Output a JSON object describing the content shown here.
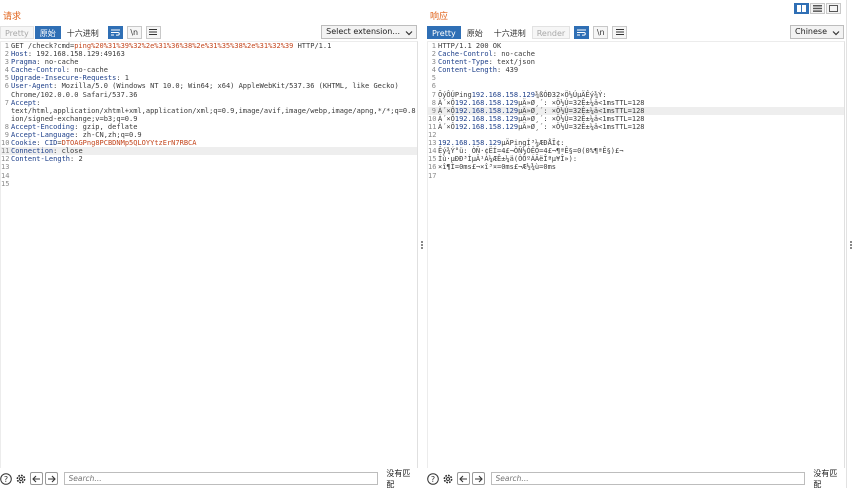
{
  "request": {
    "title": "请求",
    "tabs": [
      {
        "label": "Pretty",
        "state": "disabled"
      },
      {
        "label": "原始",
        "state": "active"
      },
      {
        "label": "十六进制",
        "state": "normal"
      }
    ],
    "icon_newline": "\\n",
    "select_label": "Select extension...",
    "lines": [
      {
        "n": "1",
        "parts": [
          {
            "t": "GET /check?cmd=",
            "c": "v"
          },
          {
            "t": "ping%20%31%39%32%2e%31%36%38%2e%31%35%38%2e%31%32%39",
            "c": "u"
          },
          {
            "t": " HTTP/1.1",
            "c": "v"
          }
        ]
      },
      {
        "n": "2",
        "parts": [
          {
            "t": "Host",
            "c": "k"
          },
          {
            "t": ": 192.168.158.129:49163",
            "c": "v"
          }
        ]
      },
      {
        "n": "3",
        "parts": [
          {
            "t": "Pragma",
            "c": "k"
          },
          {
            "t": ": no-cache",
            "c": "v"
          }
        ]
      },
      {
        "n": "4",
        "parts": [
          {
            "t": "Cache-Control",
            "c": "k"
          },
          {
            "t": ": no-cache",
            "c": "v"
          }
        ]
      },
      {
        "n": "5",
        "parts": [
          {
            "t": "Upgrade-Insecure-Requests",
            "c": "k"
          },
          {
            "t": ": 1",
            "c": "v"
          }
        ]
      },
      {
        "n": "6",
        "parts": [
          {
            "t": "User-Agent",
            "c": "k"
          },
          {
            "t": ": Mozilla/5.0 (Windows NT 10.0; Win64; x64) AppleWebKit/537.36 (KHTML, like Gecko)",
            "c": "v"
          }
        ]
      },
      {
        "n": "",
        "parts": [
          {
            "t": "Chrome/102.0.0.0 Safari/537.36",
            "c": "v"
          }
        ]
      },
      {
        "n": "7",
        "parts": [
          {
            "t": "Accept",
            "c": "k"
          },
          {
            "t": ":",
            "c": "v"
          }
        ]
      },
      {
        "n": "",
        "parts": [
          {
            "t": "text/html,application/xhtml+xml,application/xml;q=0.9,image/avif,image/webp,image/apng,*/*;q=0.8,applicat",
            "c": "v"
          }
        ]
      },
      {
        "n": "",
        "parts": [
          {
            "t": "ion/signed-exchange;v=b3;q=0.9",
            "c": "v"
          }
        ]
      },
      {
        "n": "8",
        "parts": [
          {
            "t": "Accept-Encoding",
            "c": "k"
          },
          {
            "t": ": gzip, deflate",
            "c": "v"
          }
        ]
      },
      {
        "n": "9",
        "parts": [
          {
            "t": "Accept-Language",
            "c": "k"
          },
          {
            "t": ": zh-CN,zh;q=0.9",
            "c": "v"
          }
        ]
      },
      {
        "n": "10",
        "parts": [
          {
            "t": "Cookie",
            "c": "k"
          },
          {
            "t": ": ",
            "c": "v"
          },
          {
            "t": "CID",
            "c": "k"
          },
          {
            "t": "=",
            "c": "v"
          },
          {
            "t": "DTOAGPng8PCBDNMp5QLOYYtzErN7RBCA",
            "c": "u"
          }
        ]
      },
      {
        "n": "11",
        "parts": [
          {
            "t": "Connection",
            "c": "k"
          },
          {
            "t": ": close",
            "c": "v"
          }
        ],
        "hl": true
      },
      {
        "n": "12",
        "parts": [
          {
            "t": "Content-Length",
            "c": "k"
          },
          {
            "t": ": 2",
            "c": "v"
          }
        ]
      },
      {
        "n": "13",
        "parts": []
      },
      {
        "n": "14",
        "parts": []
      },
      {
        "n": "15",
        "parts": []
      }
    ],
    "search_placeholder": "Search...",
    "match_label": "没有匹配"
  },
  "response": {
    "title": "响应",
    "tabs": [
      {
        "label": "Pretty",
        "state": "active"
      },
      {
        "label": "原始",
        "state": "normal"
      },
      {
        "label": "十六进制",
        "state": "normal"
      },
      {
        "label": "Render",
        "state": "disabled"
      }
    ],
    "icon_newline": "\\n",
    "select_label": "Chinese",
    "lines": [
      {
        "n": "1",
        "parts": [
          {
            "t": "HTTP/1.1 200 OK",
            "c": "v"
          }
        ]
      },
      {
        "n": "2",
        "parts": [
          {
            "t": "Cache-Control",
            "c": "k"
          },
          {
            "t": ": no-cache",
            "c": "v"
          }
        ]
      },
      {
        "n": "3",
        "parts": [
          {
            "t": "Content-Type",
            "c": "k"
          },
          {
            "t": ": text/json",
            "c": "v"
          }
        ]
      },
      {
        "n": "4",
        "parts": [
          {
            "t": "Content-Length",
            "c": "k"
          },
          {
            "t": ": 439",
            "c": "v"
          }
        ]
      },
      {
        "n": "5",
        "parts": []
      },
      {
        "n": "6",
        "parts": []
      },
      {
        "n": "7",
        "parts": [
          {
            "t": "ÕýÔÚPing",
            "c": "v"
          },
          {
            "t": "192.168.158.129",
            "c": "n"
          },
          {
            "t": "¾ßÓÐ32×Ö½ÚµÄÊý¾Ý:",
            "c": "v"
          }
        ]
      },
      {
        "n": "8",
        "parts": [
          {
            "t": "À´×Ô",
            "c": "v"
          },
          {
            "t": "192.168.158.129",
            "c": "n"
          },
          {
            "t": "µÄ»Ø¸´: ×Ö½Ú=32Ê±¼ä<1msTTL=128",
            "c": "v"
          }
        ]
      },
      {
        "n": "9",
        "parts": [
          {
            "t": "À´×Ô",
            "c": "v"
          },
          {
            "t": "192.168.158.129",
            "c": "n"
          },
          {
            "t": "µÄ»Ø¸´: ×Ö½Ú=32Ê±¼ä<1msTTL=128",
            "c": "v"
          }
        ],
        "hl": true
      },
      {
        "n": "10",
        "parts": [
          {
            "t": "À´×Ô",
            "c": "v"
          },
          {
            "t": "192.168.158.129",
            "c": "n"
          },
          {
            "t": "µÄ»Ø¸´: ×Ö½Ú=32Ê±¼ä<1msTTL=128",
            "c": "v"
          }
        ]
      },
      {
        "n": "11",
        "parts": [
          {
            "t": "À´×Ô",
            "c": "v"
          },
          {
            "t": "192.168.158.129",
            "c": "n"
          },
          {
            "t": "µÄ»Ø¸´: ×Ö½Ú=32Ê±¼ä<1msTTL=128",
            "c": "v"
          }
        ]
      },
      {
        "n": "12",
        "parts": []
      },
      {
        "n": "13",
        "parts": [
          {
            "t": "192.168.158.129",
            "c": "n"
          },
          {
            "t": "µÄPingÍ³¼ÆÐÅÏ¢:",
            "c": "v"
          }
        ]
      },
      {
        "n": "14",
        "parts": [
          {
            "t": "Êý¾Ý°ü: ÒÑ·¢ËÍ=4£¬ÒÑ½ÓÊÕ=4£¬¶ªÊ§=0(0%¶ªÊ§)£¬",
            "c": "v"
          }
        ]
      },
      {
        "n": "15",
        "parts": [
          {
            "t": "Íù·µÐÐ³ÌµÄ¹À¼ÆÊ±¼ä(ÒÔºÁÃëÎªµ¥Î»):",
            "c": "v"
          }
        ]
      },
      {
        "n": "16",
        "parts": [
          {
            "t": "×î¶Ì=0ms£¬×î³¤=0ms£¬Æ½¾ù=0ms",
            "c": "v"
          }
        ]
      },
      {
        "n": "17",
        "parts": []
      }
    ],
    "search_placeholder": "Search...",
    "match_label": "没有匹配"
  },
  "colors": {
    "accent": "#2f6fb5",
    "title": "#e0631b",
    "header_key": "#1d3f8a",
    "param_value": "#c4451c"
  },
  "icons": [
    "help-icon",
    "settings-gear-icon",
    "back-arrow-icon",
    "forward-arrow-icon",
    "wrap-lines-icon",
    "newline-icon",
    "menu-icon",
    "chevron-down-icon",
    "layout-split-icon",
    "layout-horizontal-icon",
    "layout-single-icon"
  ]
}
